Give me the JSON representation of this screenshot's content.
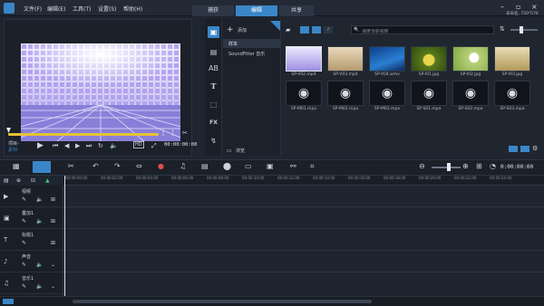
{
  "window": {
    "status": "未命名, 720*576"
  },
  "menu": [
    "文件(F)",
    "编辑(E)",
    "工具(T)",
    "设置(S)",
    "帮助(H)"
  ],
  "tabs": [
    {
      "label": "捕获"
    },
    {
      "label": "编辑"
    },
    {
      "label": "共享"
    }
  ],
  "preview": {
    "timecode": "00:00:00:00",
    "project_label": "项目-",
    "clip_label": "素材-"
  },
  "library": {
    "add_label": "添加",
    "search_placeholder": "搜索当前视图",
    "browse_label": "浏览",
    "folders": [
      "样本",
      "SoundFitter 音乐"
    ],
    "items": [
      {
        "label": "SP-V02.mp4",
        "kind": "video-tiles"
      },
      {
        "label": "SP-V03.mp4",
        "kind": "video-sand"
      },
      {
        "label": "SP-V04.wmv",
        "kind": "video-blue"
      },
      {
        "label": "SP-I01.jpg",
        "kind": "image-plant"
      },
      {
        "label": "SP-I02.jpg",
        "kind": "image-dandelion"
      },
      {
        "label": "SP-I03.jpg",
        "kind": "image-grass"
      },
      {
        "label": "SP-M01.mpa",
        "kind": "audio"
      },
      {
        "label": "SP-M02.mpa",
        "kind": "audio"
      },
      {
        "label": "SP-M03.mpa",
        "kind": "audio"
      },
      {
        "label": "SP-S01.mpa",
        "kind": "audio"
      },
      {
        "label": "SP-S02.mpa",
        "kind": "audio"
      },
      {
        "label": "SP-S03.mpa",
        "kind": "audio"
      }
    ]
  },
  "timeline": {
    "timecode": "0:00:00:00",
    "ticks": [
      "00:00:00:00",
      "00:00:02:00",
      "00:00:04:00",
      "00:00:06:00",
      "00:00:08:00",
      "00:00:10:00",
      "00:00:12:00",
      "00:00:14:00",
      "00:00:16:00",
      "00:00:18:00",
      "00:00:20:00",
      "00:00:22:00",
      "00:00:24:00"
    ],
    "tracks": [
      {
        "name": "视频"
      },
      {
        "name": "叠加1"
      },
      {
        "name": "标题1"
      },
      {
        "name": "声音"
      },
      {
        "name": "音乐1"
      }
    ]
  },
  "colors": {
    "accent": "#3a86c8",
    "bg": "#1e2430",
    "tile": "#c7bdf3"
  }
}
